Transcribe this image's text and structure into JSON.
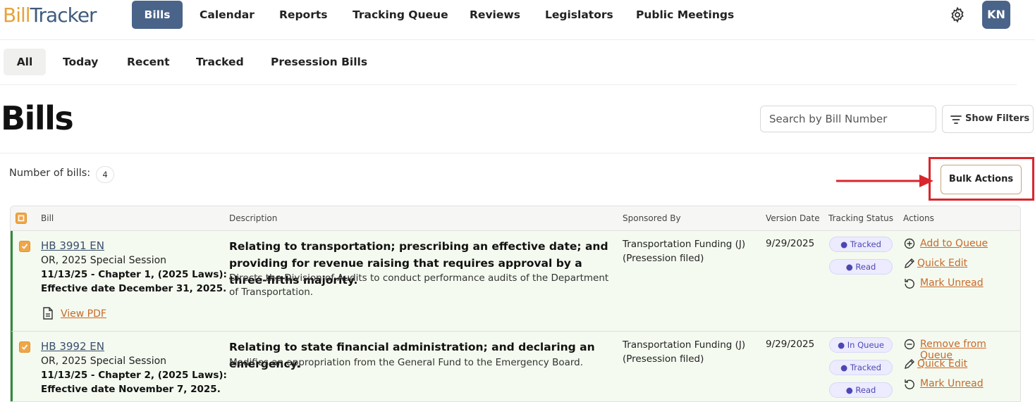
{
  "app": {
    "logo_part1": "Bill",
    "logo_part2": "Tracker"
  },
  "nav": {
    "items": [
      {
        "label": "Bills",
        "active": true
      },
      {
        "label": "Calendar"
      },
      {
        "label": "Reports"
      },
      {
        "label": "Tracking Queue"
      },
      {
        "label": "Reviews"
      },
      {
        "label": "Legislators"
      },
      {
        "label": "Public Meetings"
      }
    ],
    "settings_icon": "gear-icon",
    "avatar_initials": "KN"
  },
  "subtabs": [
    {
      "label": "All",
      "active": true
    },
    {
      "label": "Today"
    },
    {
      "label": "Recent"
    },
    {
      "label": "Tracked"
    },
    {
      "label": "Presession Bills"
    }
  ],
  "page": {
    "title": "Bills",
    "search_placeholder": "Search by Bill Number",
    "filters_label": "Show Filters",
    "count_label": "Number of bills:",
    "count": "4",
    "bulk_actions_label": "Bulk Actions"
  },
  "table": {
    "headers": [
      "Bill",
      "Description",
      "Sponsored By",
      "Version Date",
      "Tracking Status",
      "Actions"
    ],
    "rows": [
      {
        "bill_number": "HB 3991 EN",
        "session": "OR, 2025 Special Session",
        "chapter_line1": "11/13/25 - Chapter 1, (2025 Laws):",
        "chapter_line2": "Effective date December 31, 2025.",
        "pdf_label": "View PDF",
        "title": "Relating to transportation; prescribing an effective date; and providing for revenue raising that requires approval by a three-fifths majority.",
        "summary": "Directs the Division of Audits to conduct performance audits of the Department of Transportation.",
        "sponsor": "Transportation Funding (J) (Presession filed)",
        "version_date": "9/29/2025",
        "statuses": [
          "Tracked",
          "Read"
        ],
        "actions": [
          "Add to Queue",
          "Quick Edit",
          "Mark Unread"
        ]
      },
      {
        "bill_number": "HB 3992 EN",
        "session": "OR, 2025 Special Session",
        "chapter_line1": "11/13/25 - Chapter 2, (2025 Laws):",
        "chapter_line2": "Effective date November 7, 2025.",
        "title": "Relating to state financial administration; and declaring an emergency.",
        "summary": "Modifies an appropriation from the General Fund to the Emergency Board.",
        "sponsor": "Transportation Funding (J) (Presession filed)",
        "version_date": "9/29/2025",
        "statuses": [
          "In Queue",
          "Tracked",
          "Read"
        ],
        "actions": [
          "Remove from Queue",
          "Quick Edit",
          "Mark Unread"
        ]
      }
    ]
  },
  "colors": {
    "brand_blue": "#4a6389",
    "brand_orange": "#e8a23a",
    "row_bg": "#f4faef",
    "row_accent": "#2f8a3b",
    "link_orange": "#c8692b",
    "pill_bg": "#ecebff",
    "pill_text": "#4d47b3",
    "highlight_red": "#d8262c"
  }
}
